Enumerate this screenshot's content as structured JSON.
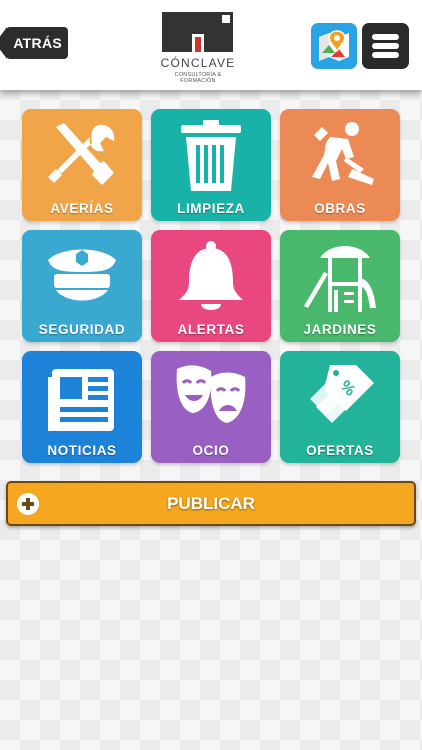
{
  "header": {
    "back_label": "ATRÁS",
    "logo_name": "CÓNCLAVE",
    "logo_tagline": "CONSULTORÍA & FORMACIÓN",
    "map_icon": "map-pin-icon",
    "menu_icon": "hamburger-menu-icon"
  },
  "categories": [
    {
      "label": "AVERÍAS",
      "icon": "tools-icon",
      "color": "#f0a548"
    },
    {
      "label": "LIMPIEZA",
      "icon": "trash-bin-icon",
      "color": "#19b2a9"
    },
    {
      "label": "OBRAS",
      "icon": "construction-worker-icon",
      "color": "#ec8a56"
    },
    {
      "label": "SEGURIDAD",
      "icon": "police-cap-icon",
      "color": "#3aa9d2"
    },
    {
      "label": "ALERTAS",
      "icon": "bell-icon",
      "color": "#e8477f"
    },
    {
      "label": "JARDINES",
      "icon": "playground-icon",
      "color": "#49b86d"
    },
    {
      "label": "NOTICIAS",
      "icon": "newspaper-icon",
      "color": "#1d83d9"
    },
    {
      "label": "OCIO",
      "icon": "theater-masks-icon",
      "color": "#9a5fc2"
    },
    {
      "label": "OFERTAS",
      "icon": "price-tags-icon",
      "color": "#22b39a"
    }
  ],
  "publish": {
    "label": "PUBLICAR",
    "icon": "plus-circle-icon",
    "color": "#f5a81f"
  }
}
